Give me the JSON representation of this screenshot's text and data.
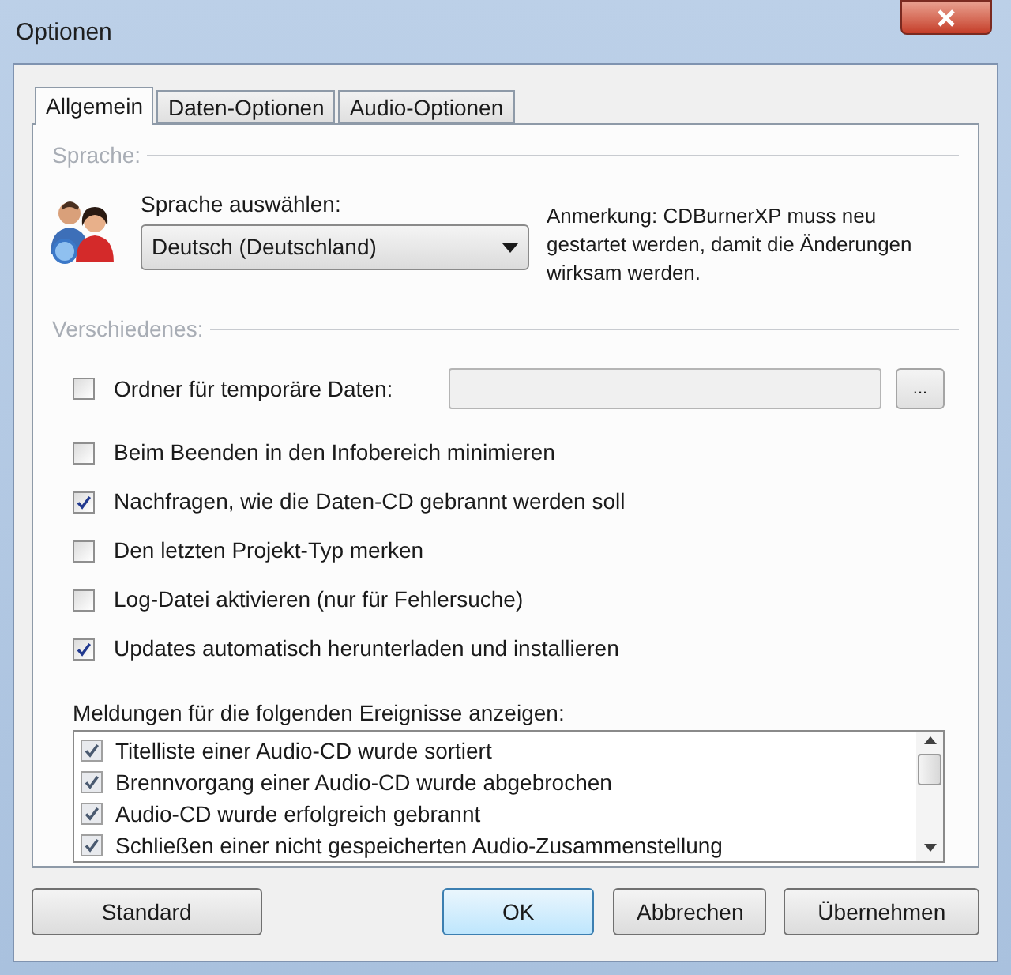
{
  "window": {
    "title": "Optionen"
  },
  "tabs": [
    {
      "label": "Allgemein",
      "selected": true
    },
    {
      "label": "Daten-Optionen",
      "selected": false
    },
    {
      "label": "Audio-Optionen",
      "selected": false
    }
  ],
  "language_section": {
    "heading": "Sprache:",
    "label": "Sprache auswählen:",
    "value": "Deutsch (Deutschland)",
    "note": "Anmerkung: CDBurnerXP muss neu gestartet werden, damit die Änderungen wirksam werden."
  },
  "misc_section": {
    "heading": "Verschiedenes:",
    "temp_folder": {
      "label": "Ordner für temporäre Daten:",
      "checked": false,
      "browse": "..."
    },
    "options": [
      {
        "label": "Beim Beenden in den Infobereich minimieren",
        "checked": false
      },
      {
        "label": "Nachfragen, wie die Daten-CD gebrannt werden soll",
        "checked": true
      },
      {
        "label": "Den letzten Projekt-Typ merken",
        "checked": false
      },
      {
        "label": "Log-Datei aktivieren (nur für Fehlersuche)",
        "checked": false
      },
      {
        "label": "Updates automatisch herunterladen und installieren",
        "checked": true
      }
    ]
  },
  "events": {
    "label": "Meldungen für die folgenden Ereignisse anzeigen:",
    "items": [
      {
        "label": "Titelliste einer Audio-CD wurde sortiert",
        "checked": true
      },
      {
        "label": "Brennvorgang einer Audio-CD wurde abgebrochen",
        "checked": true
      },
      {
        "label": "Audio-CD wurde erfolgreich gebrannt",
        "checked": true
      },
      {
        "label": "Schließen einer nicht gespeicherten Audio-Zusammenstellung",
        "checked": true
      }
    ]
  },
  "buttons": [
    {
      "label": "Standard",
      "kind": "plain"
    },
    {
      "label": "OK",
      "kind": "default"
    },
    {
      "label": "Abbrechen",
      "kind": "plain"
    },
    {
      "label": "Übernehmen",
      "kind": "plain"
    }
  ]
}
